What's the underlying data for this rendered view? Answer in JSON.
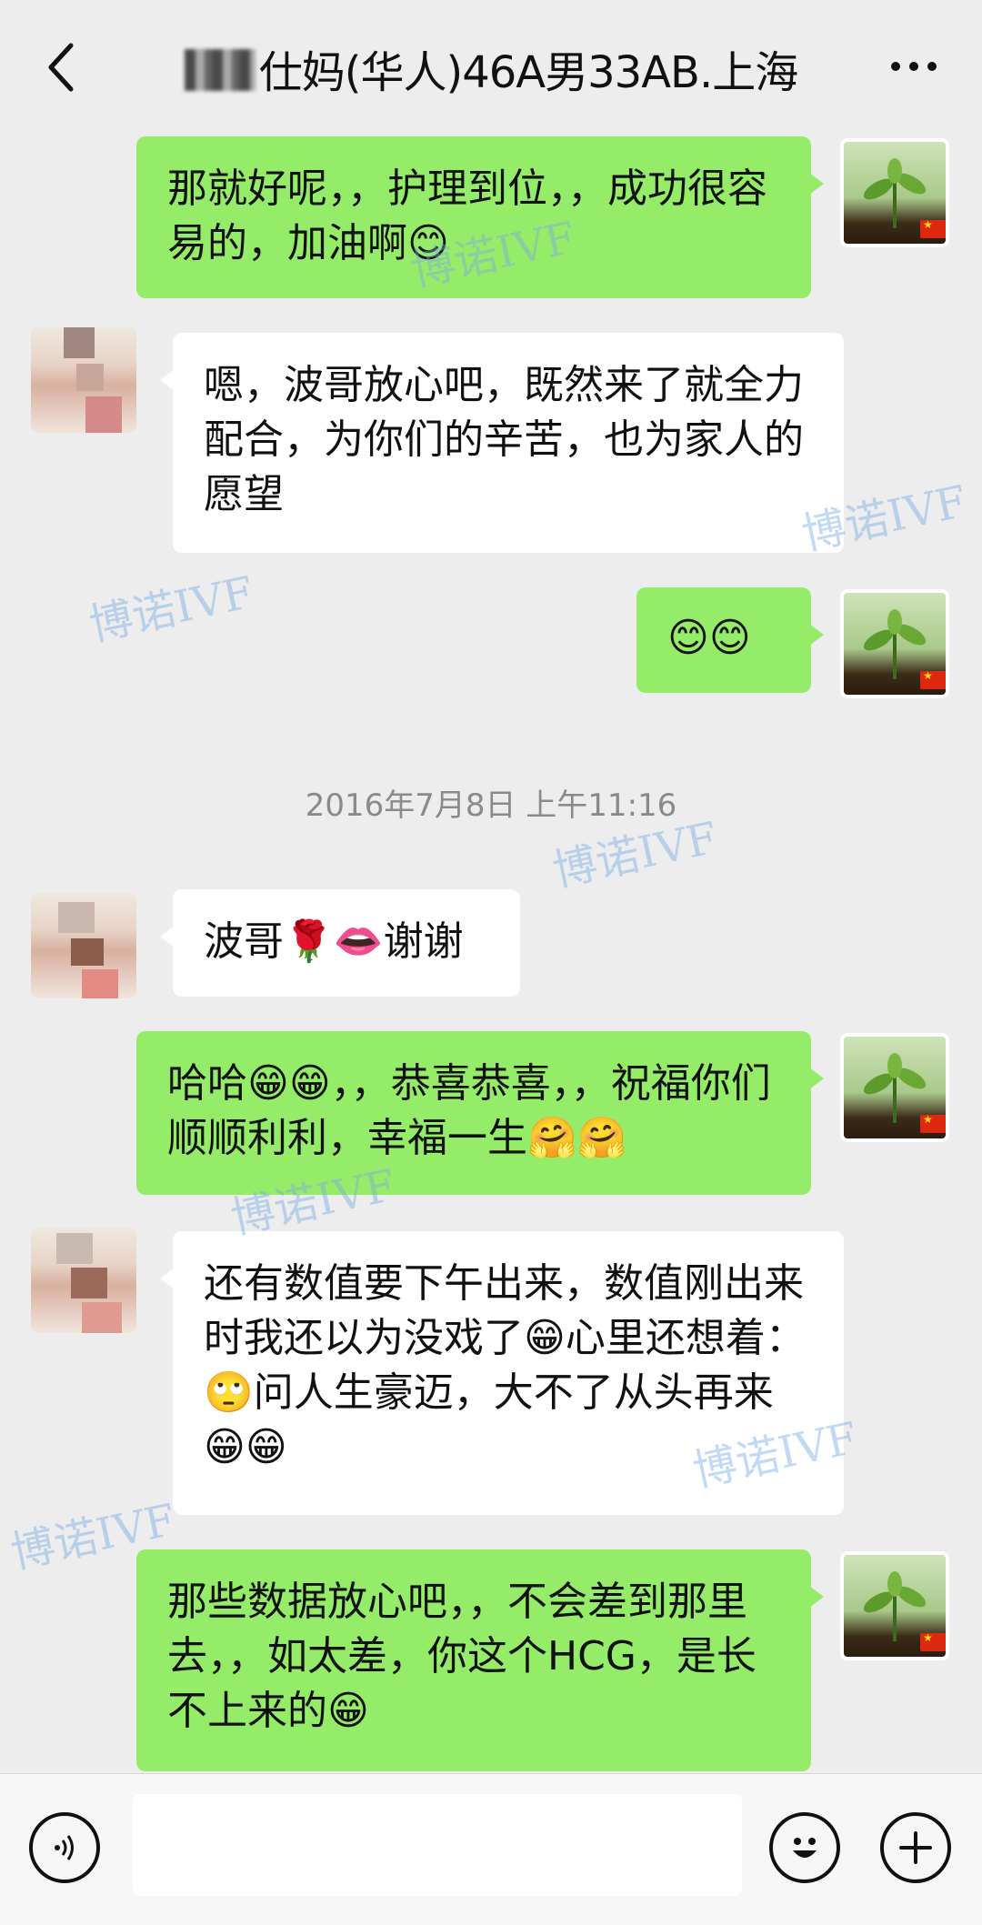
{
  "header": {
    "title": "仕妈(华人)46A男33AB.上海",
    "back_icon": "back-arrow-icon",
    "more_icon": "more-dots-icon"
  },
  "messages": [
    {
      "sender": "me",
      "text": "那就好呢，，护理到位，，成功很容易的，加油啊😊"
    },
    {
      "sender": "other",
      "text": "嗯，波哥放心吧，既然来了就全力配合，为你们的辛苦，也为家人的愿望"
    },
    {
      "sender": "me",
      "text": "😊😊"
    },
    {
      "sender": "other",
      "text": "波哥🌹👄谢谢"
    },
    {
      "sender": "me",
      "text": "哈哈😁😁，，恭喜恭喜，，祝福你们顺顺利利，幸福一生🤗🤗"
    },
    {
      "sender": "other",
      "text": "还有数值要下午出来，数值刚出来时我还以为没戏了😁心里还想着：🙄问人生豪迈，大不了从头再来😁😁"
    },
    {
      "sender": "me",
      "text": "那些数据放心吧，，不会差到那里去，，如太差，你这个HCG，是长不上来的😁"
    }
  ],
  "timestamp": "2016年7月8日 上午11:16",
  "watermark": "博诺IVF",
  "bottom": {
    "voice_icon": "voice-icon",
    "emoji_icon": "emoji-icon",
    "plus_icon": "plus-icon"
  },
  "colors": {
    "background": "#ededed",
    "my_bubble": "#95ec69",
    "their_bubble": "#ffffff",
    "watermark": "#78aae6"
  }
}
